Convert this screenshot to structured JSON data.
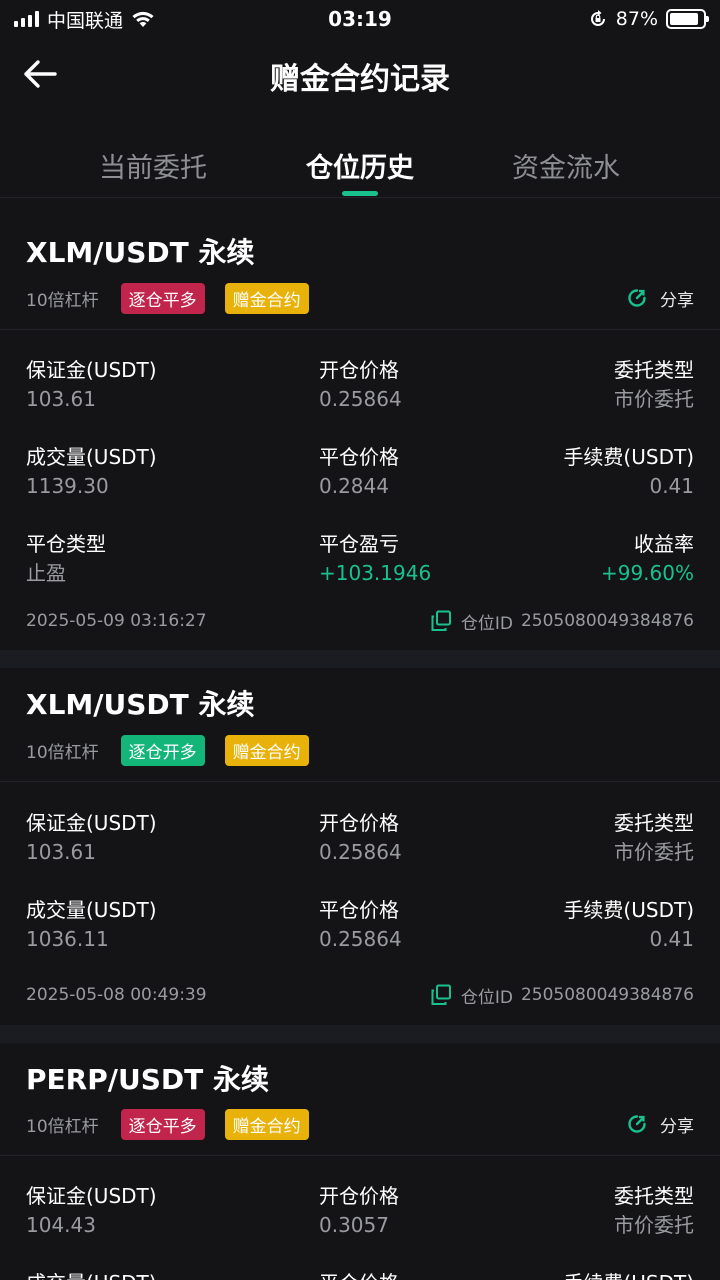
{
  "status_bar": {
    "carrier": "中国联通",
    "time": "03:19",
    "battery": "87%",
    "battery_level": 0.87
  },
  "header": {
    "title": "赠金合约记录"
  },
  "tabs": [
    {
      "label": "当前委托",
      "active": false
    },
    {
      "label": "仓位历史",
      "active": true
    },
    {
      "label": "资金流水",
      "active": false
    }
  ],
  "labels": {
    "margin": "保证金(USDT)",
    "open_price": "开仓价格",
    "order_type": "委托类型",
    "volume": "成交量(USDT)",
    "close_price": "平仓价格",
    "fee": "手续费(USDT)",
    "close_type": "平仓类型",
    "pnl": "平仓盈亏",
    "roi": "收益率",
    "share": "分享",
    "position_id_prefix": "仓位ID"
  },
  "positions": [
    {
      "title": "XLM/USDT 永续",
      "leverage": "10倍杠杆",
      "direction_tag": "逐仓平多",
      "bonus_tag": "赠金合约",
      "margin": "103.61",
      "open_price": "0.25864",
      "order_type": "市价委托",
      "volume": "1139.30",
      "close_price": "0.2844",
      "fee": "0.41",
      "close_type": "止盈",
      "pnl": "+103.1946",
      "roi": "+99.60%",
      "timestamp": "2025-05-09 03:16:27",
      "position_id": "2505080049384876"
    },
    {
      "title": "XLM/USDT 永续",
      "leverage": "10倍杠杆",
      "direction_tag": "逐仓开多",
      "bonus_tag": "赠金合约",
      "margin": "103.61",
      "open_price": "0.25864",
      "order_type": "市价委托",
      "volume": "1036.11",
      "close_price": "0.25864",
      "fee": "0.41",
      "timestamp": "2025-05-08 00:49:39",
      "position_id": "2505080049384876"
    },
    {
      "title": "PERP/USDT 永续",
      "leverage": "10倍杠杆",
      "direction_tag": "逐仓平多",
      "bonus_tag": "赠金合约",
      "margin": "104.43",
      "open_price": "0.3057",
      "order_type": "市价委托"
    }
  ],
  "colors": {
    "accent": "#19c28c",
    "tag_close": "#c2254c",
    "tag_open": "#13b579",
    "tag_bonus": "#e8b20b",
    "background": "#141416"
  }
}
